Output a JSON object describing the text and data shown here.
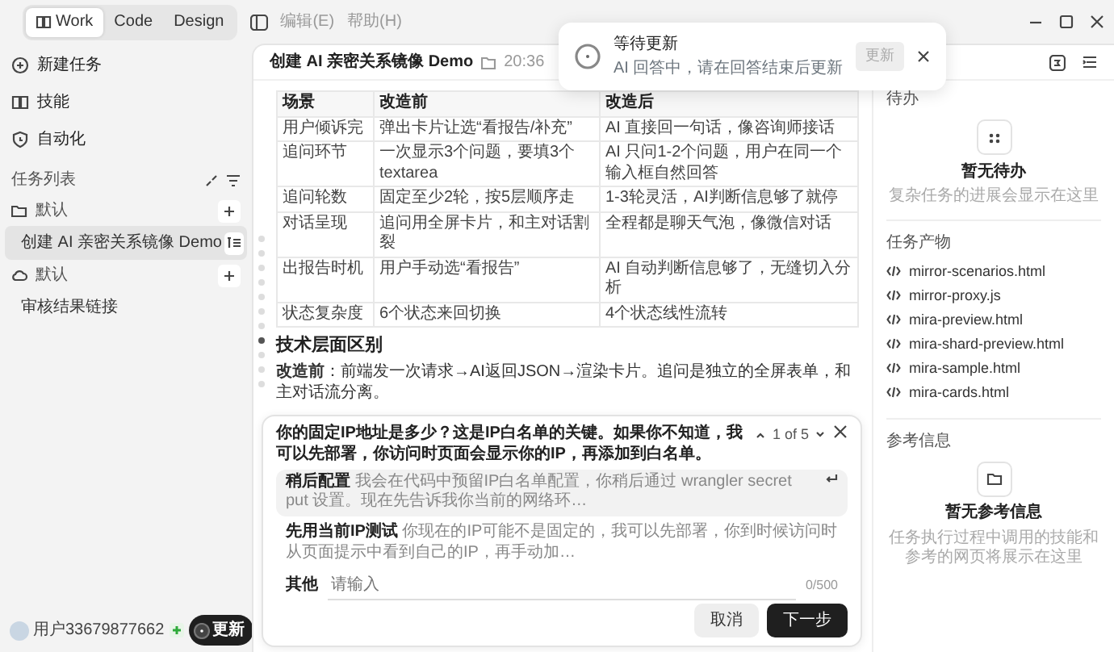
{
  "app_modes": [
    {
      "label": "Work",
      "selected": true
    },
    {
      "label": "Code",
      "selected": false
    },
    {
      "label": "Design",
      "selected": false
    }
  ],
  "menu": [
    "编辑(E)",
    "帮助(H)"
  ],
  "sidebar": {
    "actions": [
      {
        "label": "新建任务",
        "kind": "new"
      },
      {
        "label": "技能",
        "kind": "skills"
      },
      {
        "label": "自动化",
        "kind": "automation"
      }
    ],
    "task_list_title": "任务列表",
    "groups": [
      {
        "label": "默认",
        "kind": "folder",
        "children": [
          {
            "label": "创建 AI 亲密关系镜像 Demo",
            "selected": true
          }
        ]
      },
      {
        "label": "默认",
        "kind": "cloud",
        "children": [
          {
            "label": "审核结果链接",
            "selected": false
          }
        ]
      }
    ],
    "user": {
      "name": "用户33679877662",
      "update_button": "更新"
    }
  },
  "toast": {
    "title": "等待更新",
    "message": "AI 回答中，请在回答结束后更新",
    "button": "更新",
    "button_disabled": true
  },
  "header": {
    "title": "创建 AI 亲密关系镜像 Demo",
    "time": "20:36"
  },
  "document": {
    "table": {
      "columns": [
        "场景",
        "改造前",
        "改造后"
      ],
      "rows": [
        [
          "用户倾诉完",
          "弹出卡片让选“看报告/补充”",
          "AI 直接回一句话，像咨询师接话"
        ],
        [
          "追问环节",
          "一次显示3个问题，要填3个textarea",
          "AI 只问1-2个问题，用户在同一个输入框自然回答"
        ],
        [
          "追问轮数",
          "固定至少2轮，按5层顺序走",
          "1-3轮灵活，AI判断信息够了就停"
        ],
        [
          "对话呈现",
          "追问用全屏卡片，和主对话割裂",
          "全程都是聊天气泡，像微信对话"
        ],
        [
          "出报告时机",
          "用户手动选“看报告”",
          "AI 自动判断信息够了，无缝切入分析"
        ],
        [
          "状态复杂度",
          "6个状态来回切换",
          "4个状态线性流转"
        ]
      ]
    },
    "heading": "技术层面区别",
    "paragraphs": [
      "**改造前**：前端发一次请求→AI返回JSON→渲染卡片。追问是独立的全屏表单，和主对话流分离。"
    ]
  },
  "nav_dots": [
    {
      "selected": false
    },
    {
      "selected": false
    },
    {
      "selected": false
    },
    {
      "selected": false
    },
    {
      "selected": false
    },
    {
      "selected": false
    },
    {
      "selected": false
    },
    {
      "selected": true
    },
    {
      "selected": false
    },
    {
      "selected": false
    },
    {
      "selected": false
    }
  ],
  "question": {
    "title": "你的固定IP地址是多少？这是IP白名单的关键。如果你不知道，我可以先部署，你访问时页面会显示你的IP，再添加到白名单。",
    "pager": "1 of 5",
    "options": [
      {
        "label": "稍后配置",
        "text": "我会在代码中预留IP白名单配置，你稍后通过 wrangler secret put 设置。现在先告诉我你当前的网络环…",
        "selected": true
      },
      {
        "label": "先用当前IP测试",
        "text": "你现在的IP可能不是固定的，我可以先部署，你到时候访问时从页面提示中看到自己的IP，再手动加…",
        "selected": false
      }
    ],
    "other": {
      "label": "其他",
      "placeholder": "请输入",
      "counter": "0/500"
    },
    "buttons": [
      {
        "label": "取消",
        "kind": "secondary"
      },
      {
        "label": "下一步",
        "kind": "primary"
      }
    ]
  },
  "right_panel": {
    "todo": {
      "title": "待办",
      "empty_title": "暂无待办",
      "empty_text": "复杂任务的进展会显示在这里"
    },
    "artifacts": {
      "title": "任务产物",
      "files": [
        "mirror-scenarios.html",
        "mirror-proxy.js",
        "mira-preview.html",
        "mira-shard-preview.html",
        "mira-sample.html",
        "mira-cards.html"
      ]
    },
    "references": {
      "title": "参考信息",
      "empty_title": "暂无参考信息",
      "empty_text": "任务执行过程中调用的技能和参考的网页将展示在这里"
    }
  }
}
